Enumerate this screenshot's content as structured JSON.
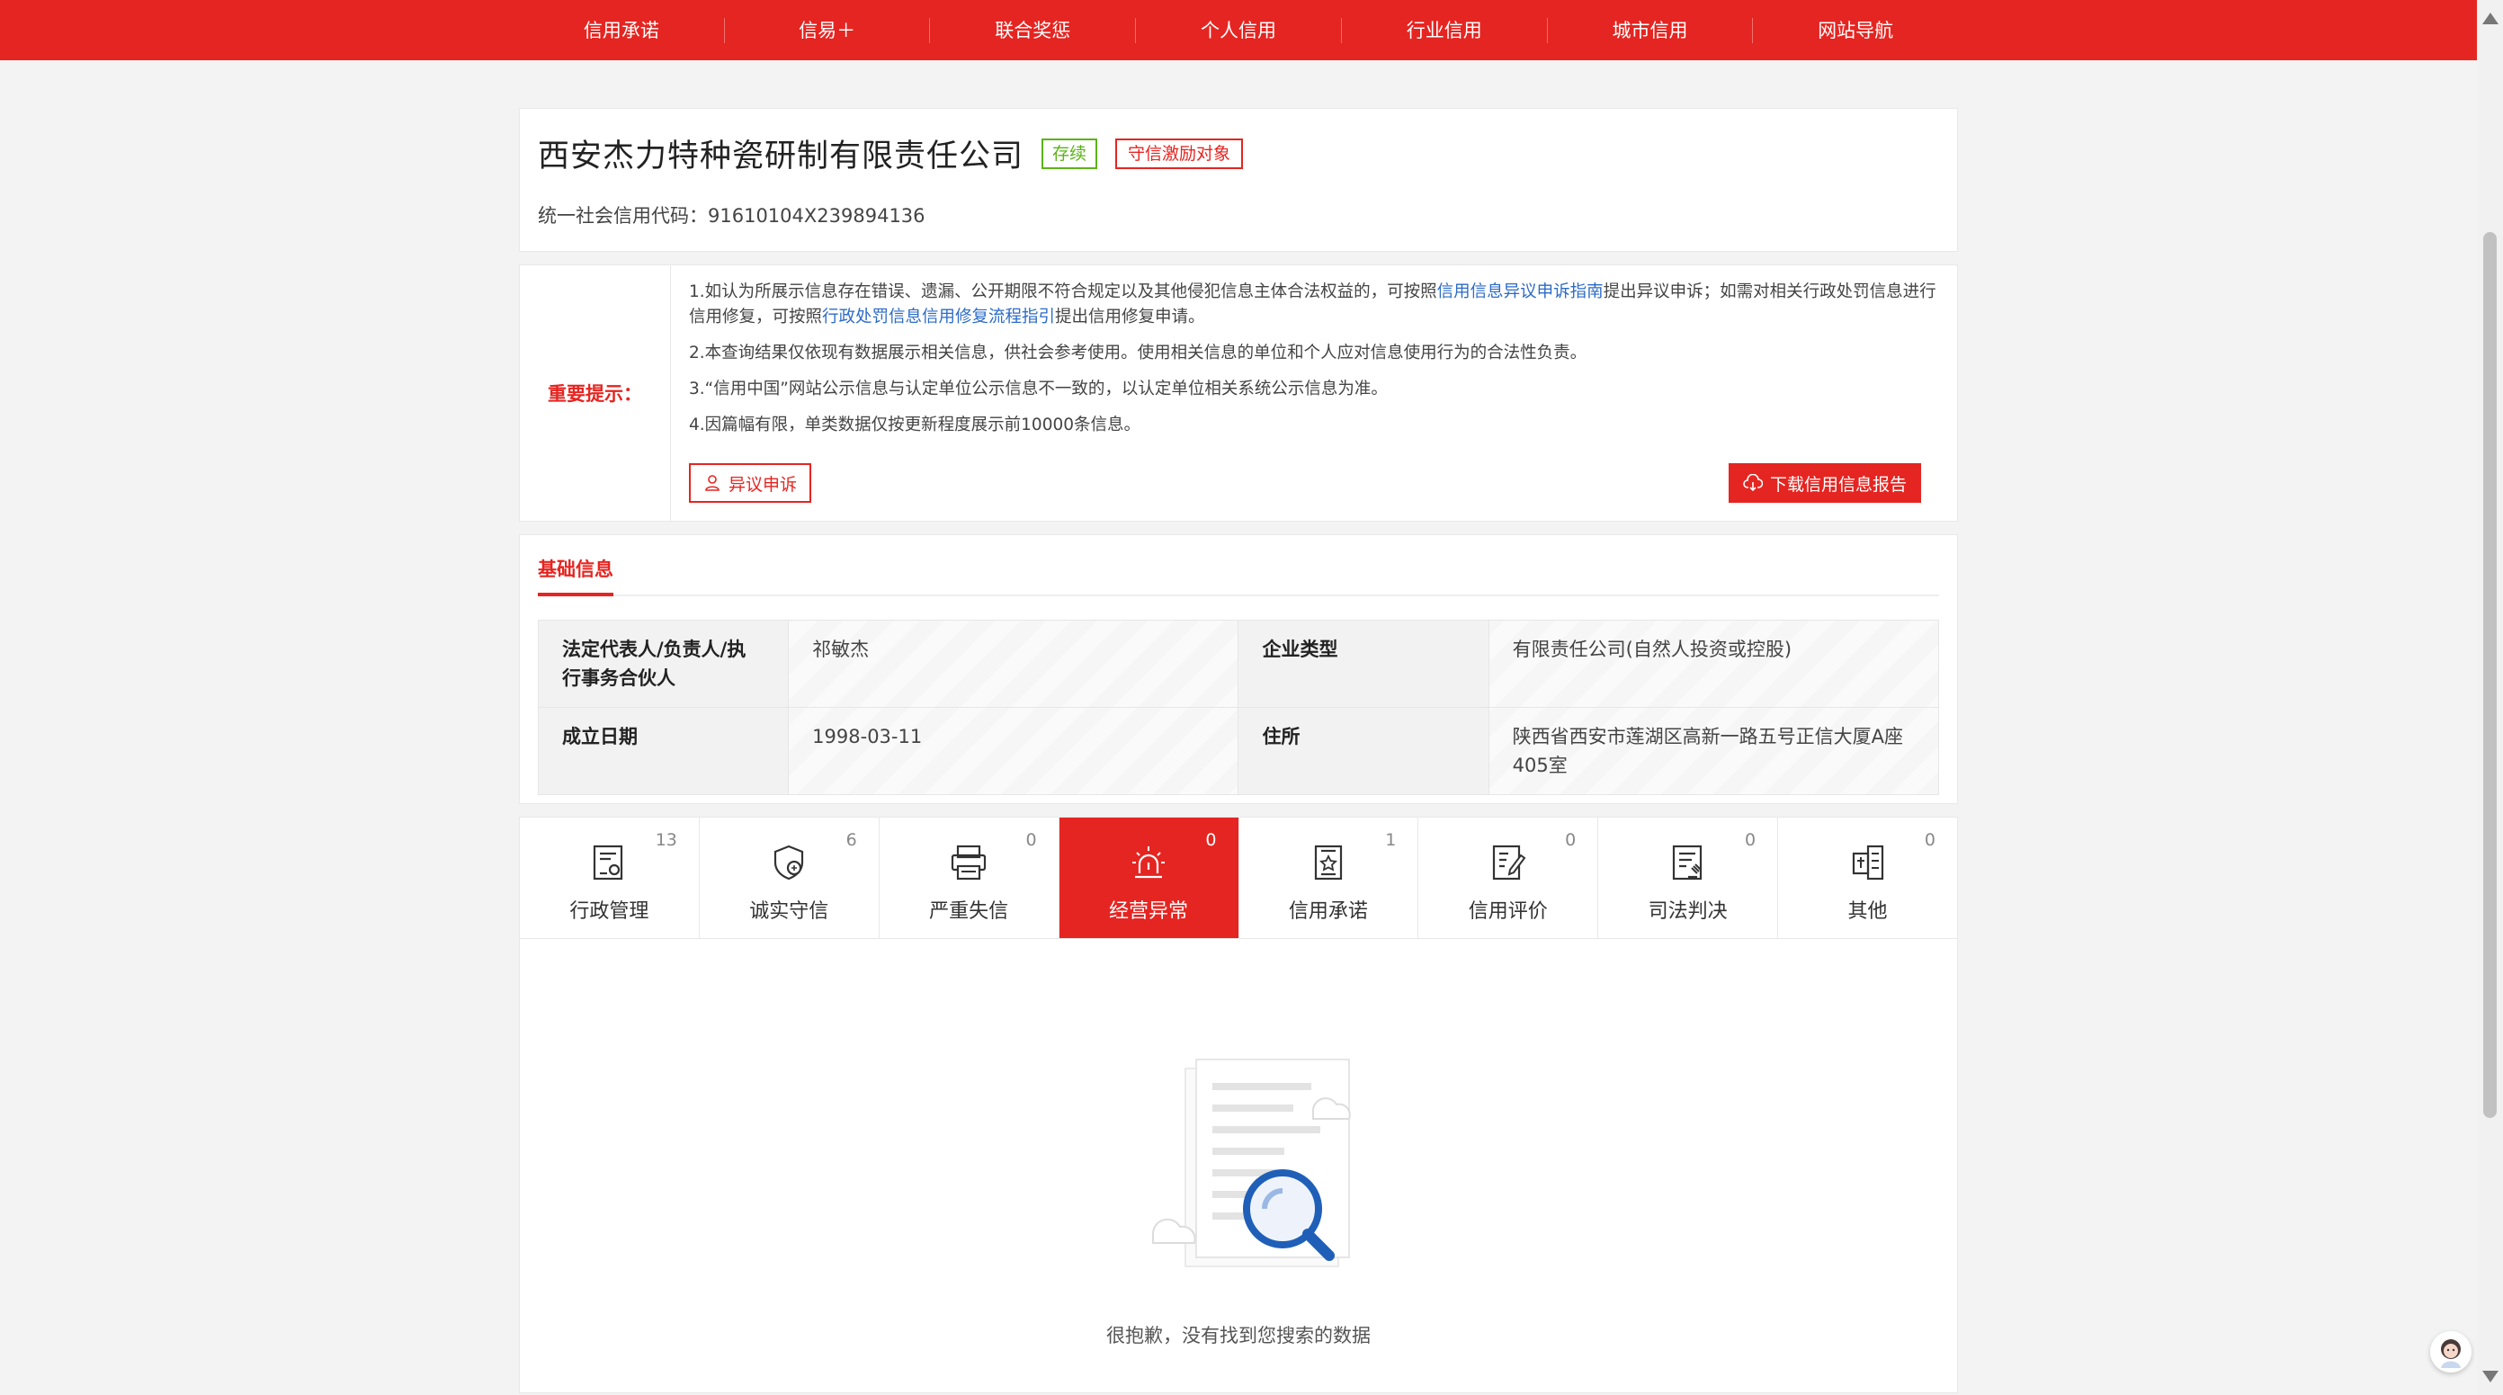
{
  "nav": {
    "items": [
      "信用承诺",
      "信易＋",
      "联合奖惩",
      "个人信用",
      "行业信用",
      "城市信用",
      "网站导航"
    ]
  },
  "company": {
    "name": "西安杰力特种瓷研制有限责任公司",
    "status_tag": "存续",
    "reward_tag": "守信激励对象",
    "credit_code_label": "统一社会信用代码：",
    "credit_code": "91610104X239894136"
  },
  "notice": {
    "label": "重要提示：",
    "line1_a": "1.如认为所展示信息存在错误、遗漏、公开期限不符合规定以及其他侵犯信息主体合法权益的，可按照",
    "line1_link1": "信用信息异议申诉指南",
    "line1_b": "提出异议申诉；如需对相关行政处罚信息进行信用修复，可按照",
    "line1_link2": "行政处罚信息信用修复流程指引",
    "line1_c": "提出信用修复申请。",
    "line2": "2.本查询结果仅依现有数据展示相关信息，供社会参考使用。使用相关信息的单位和个人应对信息使用行为的合法性负责。",
    "line3": "3.“信用中国”网站公示信息与认定单位公示信息不一致的，以认定单位相关系统公示信息为准。",
    "line4": "4.因篇幅有限，单类数据仅按更新程度展示前10000条信息。",
    "appeal_button": "异议申诉",
    "download_button": "下载信用信息报告"
  },
  "basic": {
    "tab": "基础信息",
    "rows": [
      {
        "k1": "法定代表人/负责人/执行事务合伙人",
        "v1": "祁敏杰",
        "k2": "企业类型",
        "v2": "有限责任公司(自然人投资或控股)"
      },
      {
        "k1": "成立日期",
        "v1": "1998-03-11",
        "k2": "住所",
        "v2": "陕西省西安市莲湖区高新一路五号正信大厦A座405室"
      }
    ]
  },
  "categories": [
    {
      "label": "行政管理",
      "count": "13",
      "icon": "admin-icon"
    },
    {
      "label": "诚实守信",
      "count": "6",
      "icon": "shield-icon"
    },
    {
      "label": "严重失信",
      "count": "0",
      "icon": "discredit-icon"
    },
    {
      "label": "经营异常",
      "count": "0",
      "icon": "alarm-icon"
    },
    {
      "label": "信用承诺",
      "count": "1",
      "icon": "promise-icon"
    },
    {
      "label": "信用评价",
      "count": "0",
      "icon": "evaluation-icon"
    },
    {
      "label": "司法判决",
      "count": "0",
      "icon": "judgement-icon"
    },
    {
      "label": "其他",
      "count": "0",
      "icon": "other-icon"
    }
  ],
  "active_category": "经营异常",
  "empty": {
    "message": "很抱歉，没有找到您搜索的数据"
  },
  "colors": {
    "brand_red": "#e52521",
    "status_green": "#5bb318",
    "link_blue": "#2c6bc7"
  }
}
